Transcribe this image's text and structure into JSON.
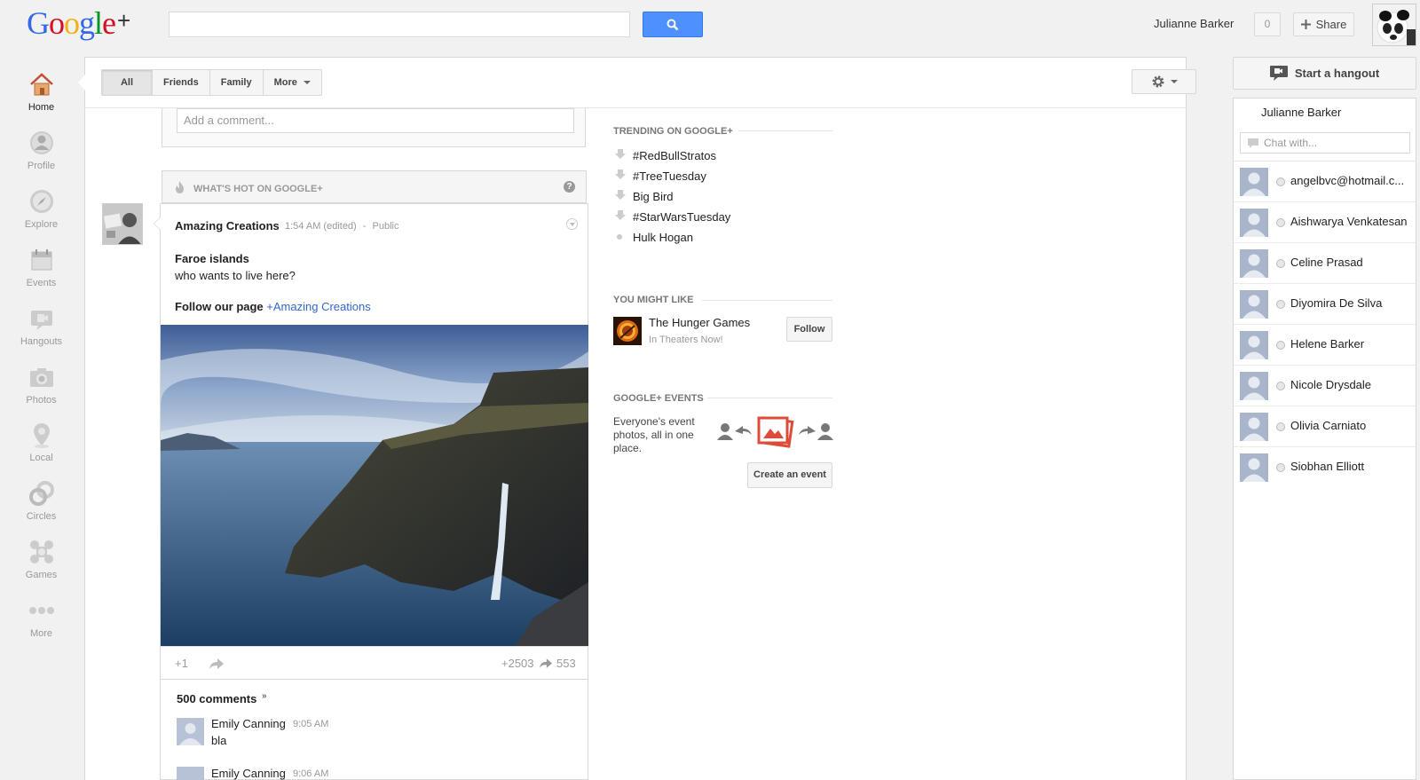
{
  "header": {
    "logo_text": "Google",
    "logo_plus": "+",
    "search_placeholder": "",
    "user_name": "Julianne Barker",
    "notification_count": "0",
    "share_label": "Share"
  },
  "sidebar": {
    "items": [
      {
        "label": "Home",
        "icon": "home-icon"
      },
      {
        "label": "Profile",
        "icon": "profile-icon"
      },
      {
        "label": "Explore",
        "icon": "compass-icon"
      },
      {
        "label": "Events",
        "icon": "calendar-icon"
      },
      {
        "label": "Hangouts",
        "icon": "video-camera-icon"
      },
      {
        "label": "Photos",
        "icon": "camera-icon"
      },
      {
        "label": "Local",
        "icon": "map-pin-icon"
      },
      {
        "label": "Circles",
        "icon": "circles-icon"
      },
      {
        "label": "Games",
        "icon": "games-icon"
      },
      {
        "label": "More",
        "icon": "more-dots-icon"
      }
    ]
  },
  "stream": {
    "filters": [
      "All",
      "Friends",
      "Family",
      "More"
    ],
    "comment_placeholder": "Add a comment...",
    "whats_hot_label": "WHAT'S HOT ON GOOGLE+",
    "post": {
      "author": "Amazing Creations",
      "time": "1:54 AM (edited)",
      "separator": "-",
      "visibility": "Public",
      "title": "Faroe islands",
      "body": "who wants to live here?",
      "follow_text": "Follow our page",
      "follow_link": "+Amazing Creations",
      "plus_one": "+1",
      "plus_count": "+2503",
      "share_count": "553"
    },
    "comments_count_label": "500 comments",
    "comments": [
      {
        "author": "Emily Canning",
        "time": "9:05 AM",
        "text": "bla"
      },
      {
        "author": "Emily Canning",
        "time": "9:06 AM",
        "text": ""
      }
    ]
  },
  "trending": {
    "title": "TRENDING ON GOOGLE+",
    "items": [
      "#RedBullStratos",
      "#TreeTuesday",
      "Big Bird",
      "#StarWarsTuesday",
      "Hulk Hogan"
    ]
  },
  "might_like": {
    "title": "YOU MIGHT LIKE",
    "page_name": "The Hunger Games",
    "page_subtitle": "In Theaters Now!",
    "follow_label": "Follow"
  },
  "events": {
    "title": "GOOGLE+ EVENTS",
    "description": "Everyone's event photos, all in one place.",
    "create_label": "Create an event"
  },
  "chat": {
    "hangout_label": "Start a hangout",
    "user_name": "Julianne Barker",
    "chat_placeholder": "Chat with...",
    "contacts": [
      "angelbvc@hotmail.c...",
      "Aishwarya Venkatesan",
      "Celine Prasad",
      "Diyomira De Silva",
      "Helene Barker",
      "Nicole Drysdale",
      "Olivia Carniato",
      "Siobhan Elliott"
    ]
  },
  "colors": {
    "google_blue": "#3369e8",
    "google_red": "#d50f25",
    "google_yellow": "#eeb211",
    "google_green": "#009925",
    "search_button": "#4d90fe",
    "link": "#3366cc"
  }
}
